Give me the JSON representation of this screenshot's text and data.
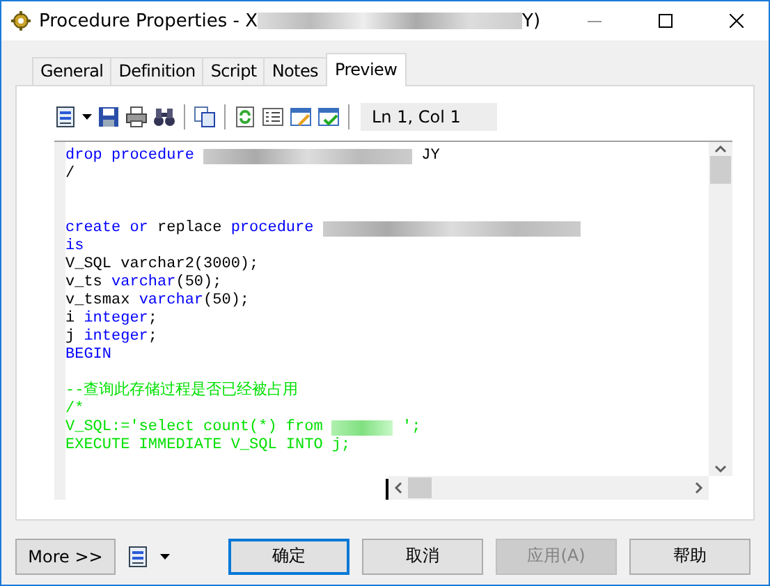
{
  "window": {
    "title": {
      "start": "Procedure Properties - X",
      "end": "Y)"
    }
  },
  "tabs": [
    {
      "label": "General",
      "selected": false
    },
    {
      "label": "Definition",
      "selected": false
    },
    {
      "label": "Script",
      "selected": false
    },
    {
      "label": "Notes",
      "selected": false
    },
    {
      "label": "Preview",
      "selected": true
    }
  ],
  "toolbar": {
    "position": "Ln 1, Col 1"
  },
  "editor": {
    "lines": [
      {
        "kind": "code",
        "tokens": [
          {
            "kind": "keyword",
            "text": "drop procedure"
          },
          {
            "kind": "redacted"
          },
          {
            "kind": "plain",
            "text": "JY"
          }
        ]
      },
      {
        "kind": "code",
        "tokens": [
          {
            "kind": "plain",
            "text": "/"
          }
        ]
      },
      {
        "kind": "blank"
      },
      {
        "kind": "blank"
      },
      {
        "kind": "code",
        "tokens": [
          {
            "kind": "keyword",
            "text": "create or "
          },
          {
            "kind": "plain",
            "text": "replace "
          },
          {
            "kind": "keyword",
            "text": "procedure"
          },
          {
            "kind": "redacted"
          }
        ]
      },
      {
        "kind": "code",
        "tokens": [
          {
            "kind": "keyword",
            "text": "is"
          }
        ]
      },
      {
        "kind": "code",
        "tokens": [
          {
            "kind": "plain",
            "text": "V_SQL varchar2(3000);"
          }
        ]
      },
      {
        "kind": "code",
        "tokens": [
          {
            "kind": "plain",
            "text": "v_ts "
          },
          {
            "kind": "keyword",
            "text": "varchar"
          },
          {
            "kind": "plain",
            "text": "(50);"
          }
        ]
      },
      {
        "kind": "code",
        "tokens": [
          {
            "kind": "plain",
            "text": "v_tsmax "
          },
          {
            "kind": "keyword",
            "text": "varchar"
          },
          {
            "kind": "plain",
            "text": "(50);"
          }
        ]
      },
      {
        "kind": "code",
        "tokens": [
          {
            "kind": "plain",
            "text": "i "
          },
          {
            "kind": "keyword",
            "text": "integer"
          },
          {
            "kind": "plain",
            "text": ";"
          }
        ]
      },
      {
        "kind": "code",
        "tokens": [
          {
            "kind": "plain",
            "text": "j "
          },
          {
            "kind": "keyword",
            "text": "integer"
          },
          {
            "kind": "plain",
            "text": ";"
          }
        ]
      },
      {
        "kind": "code",
        "tokens": [
          {
            "kind": "keyword",
            "text": "BEGIN"
          }
        ]
      },
      {
        "kind": "blank"
      },
      {
        "kind": "code",
        "tokens": [
          {
            "kind": "comment",
            "text": "--查询此存储过程是否已经被占用"
          }
        ]
      },
      {
        "kind": "code",
        "tokens": [
          {
            "kind": "comment",
            "text": "/*"
          }
        ]
      },
      {
        "kind": "code",
        "tokens": [
          {
            "kind": "comment",
            "text": "V_SQL:='select count(*) from"
          },
          {
            "kind": "redacted"
          },
          {
            "kind": "comment",
            "text": "';"
          }
        ]
      },
      {
        "kind": "code",
        "tokens": [
          {
            "kind": "comment",
            "text": "EXECUTE IMMEDIATE V_SQL INTO j;"
          }
        ]
      }
    ]
  },
  "more_button": "More >>",
  "buttons": [
    {
      "label": "确定",
      "default": true,
      "disabled": false
    },
    {
      "label": "取消",
      "default": false,
      "disabled": false
    },
    {
      "label": "应用(A)",
      "default": false,
      "disabled": true
    },
    {
      "label": "帮助",
      "default": false,
      "disabled": false
    }
  ]
}
